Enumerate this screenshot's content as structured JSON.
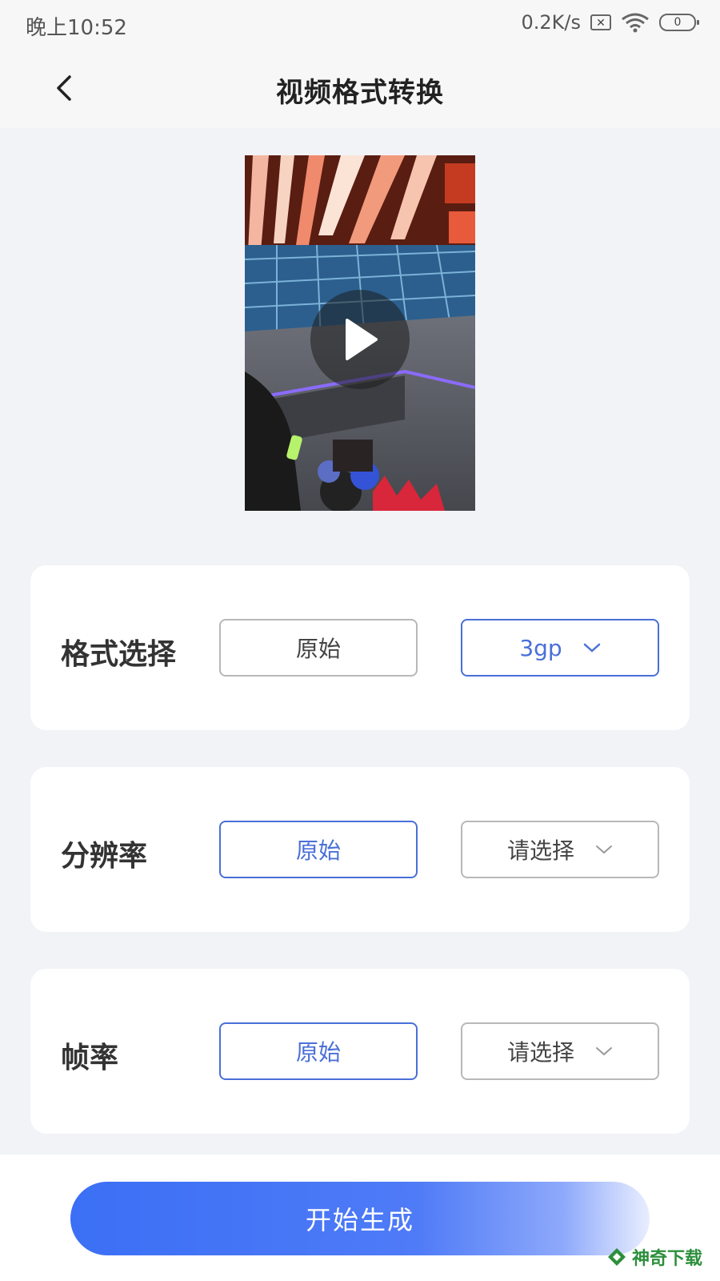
{
  "status_bar": {
    "time": "晚上10:52",
    "net_speed": "0.2K/s",
    "battery_level": "0"
  },
  "app_bar": {
    "title": "视频格式转换"
  },
  "settings": [
    {
      "label": "格式选择",
      "left_option": "原始",
      "right_option": "3gp",
      "selected": "right"
    },
    {
      "label": "分辨率",
      "left_option": "原始",
      "right_option": "请选择",
      "selected": "left"
    },
    {
      "label": "帧率",
      "left_option": "原始",
      "right_option": "请选择",
      "selected": "left"
    }
  ],
  "actions": {
    "generate_label": "开始生成"
  },
  "watermark": {
    "text": "神奇下载"
  },
  "colors": {
    "accent": "#4a6fd8",
    "button_gradient_start": "#3b6ff5",
    "background": "#f2f3f7"
  }
}
